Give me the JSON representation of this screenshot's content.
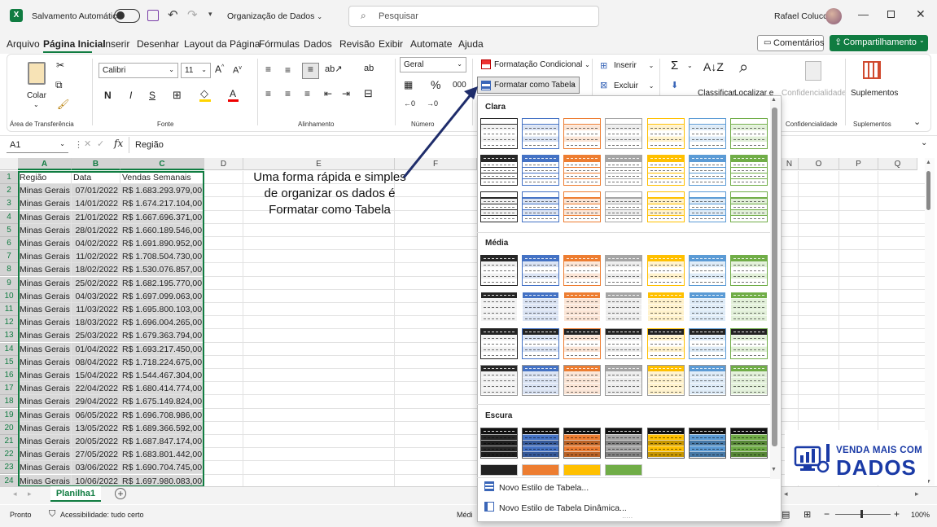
{
  "title_bar": {
    "app_logo": "X",
    "autosave_label": "Salvamento Automático",
    "file_name": "Organização de Dados",
    "search_placeholder": "Pesquisar",
    "user_name": "Rafael Colucci"
  },
  "menu": {
    "items": [
      "Arquivo",
      "Página Inicial",
      "Inserir",
      "Desenhar",
      "Layout da Página",
      "Fórmulas",
      "Dados",
      "Revisão",
      "Exibir",
      "Automate",
      "Ajuda"
    ],
    "active": "Página Inicial",
    "comments_label": "Comentários",
    "share_label": "Compartilhamento"
  },
  "ribbon": {
    "paste_label": "Colar",
    "clipboard_group": "Área de Transferência",
    "font_name": "Calibri",
    "font_size": "11",
    "font_group": "Fonte",
    "alignment_group": "Alinhamento",
    "number_format": "Geral",
    "number_group": "Número",
    "conditional_format": "Formatação Condicional",
    "format_as_table": "Formatar como Tabela",
    "insert": "Inserir",
    "delete": "Excluir",
    "classify": "Classificar",
    "find": "Localizar e",
    "sensitivity": "Confidencialidade",
    "sensitivity_group": "Confidencialidade",
    "addins": "Suplementos",
    "addins_group": "Suplementos"
  },
  "formula_bar": {
    "name_box": "A1",
    "fx": "fx",
    "content": "Região"
  },
  "grid": {
    "columns": [
      "A",
      "B",
      "C",
      "D",
      "E",
      "F",
      "O",
      "P",
      "Q"
    ],
    "column_N_partial": "N",
    "headers": [
      "Região",
      "Data",
      "Vendas Semanais"
    ],
    "rows": [
      [
        "Minas Gerais",
        "07/01/2022",
        "R$  1.683.293.979,00"
      ],
      [
        "Minas Gerais",
        "14/01/2022",
        "R$  1.674.217.104,00"
      ],
      [
        "Minas Gerais",
        "21/01/2022",
        "R$  1.667.696.371,00"
      ],
      [
        "Minas Gerais",
        "28/01/2022",
        "R$  1.660.189.546,00"
      ],
      [
        "Minas Gerais",
        "04/02/2022",
        "R$  1.691.890.952,00"
      ],
      [
        "Minas Gerais",
        "11/02/2022",
        "R$  1.708.504.730,00"
      ],
      [
        "Minas Gerais",
        "18/02/2022",
        "R$  1.530.076.857,00"
      ],
      [
        "Minas Gerais",
        "25/02/2022",
        "R$  1.682.195.770,00"
      ],
      [
        "Minas Gerais",
        "04/03/2022",
        "R$  1.697.099.063,00"
      ],
      [
        "Minas Gerais",
        "11/03/2022",
        "R$  1.695.800.103,00"
      ],
      [
        "Minas Gerais",
        "18/03/2022",
        "R$  1.696.004.265,00"
      ],
      [
        "Minas Gerais",
        "25/03/2022",
        "R$  1.679.363.794,00"
      ],
      [
        "Minas Gerais",
        "01/04/2022",
        "R$  1.693.217.450,00"
      ],
      [
        "Minas Gerais",
        "08/04/2022",
        "R$  1.718.224.675,00"
      ],
      [
        "Minas Gerais",
        "15/04/2022",
        "R$  1.544.467.304,00"
      ],
      [
        "Minas Gerais",
        "22/04/2022",
        "R$  1.680.414.774,00"
      ],
      [
        "Minas Gerais",
        "29/04/2022",
        "R$  1.675.149.824,00"
      ],
      [
        "Minas Gerais",
        "06/05/2022",
        "R$  1.696.708.986,00"
      ],
      [
        "Minas Gerais",
        "13/05/2022",
        "R$  1.689.366.592,00"
      ],
      [
        "Minas Gerais",
        "20/05/2022",
        "R$  1.687.847.174,00"
      ],
      [
        "Minas Gerais",
        "27/05/2022",
        "R$  1.683.801.442,00"
      ],
      [
        "Minas Gerais",
        "03/06/2022",
        "R$  1.690.704.745,00"
      ],
      [
        "Minas Gerais",
        "10/06/2022",
        "R$  1.697.980.083,00"
      ]
    ]
  },
  "annotation": "Uma forma rápida e simples de organizar os dados é Formatar como Tabela",
  "gallery": {
    "section_light": "Clara",
    "section_medium": "Média",
    "section_dark": "Escura",
    "new_table_style": "Novo Estilo de Tabela...",
    "new_pivot_style": "Novo Estilo de Tabela Dinâmica...",
    "colors": [
      "#262626",
      "#4472c4",
      "#ed7d31",
      "#a5a5a5",
      "#ffc000",
      "#5b9bd5",
      "#70ad47"
    ],
    "light_colors": [
      "#f2f2f2",
      "#dae3f3",
      "#fbe5d6",
      "#ededed",
      "#fff2cc",
      "#deebf7",
      "#e2f0d9"
    ]
  },
  "sheet": {
    "tab": "Planilha1"
  },
  "status": {
    "ready": "Pronto",
    "accessibility": "Acessibilidade: tudo certo",
    "media_partial": "Médi",
    "zoom": "100%"
  },
  "watermark": {
    "line1": "VENDA MAIS COM",
    "line2": "DADOS"
  }
}
